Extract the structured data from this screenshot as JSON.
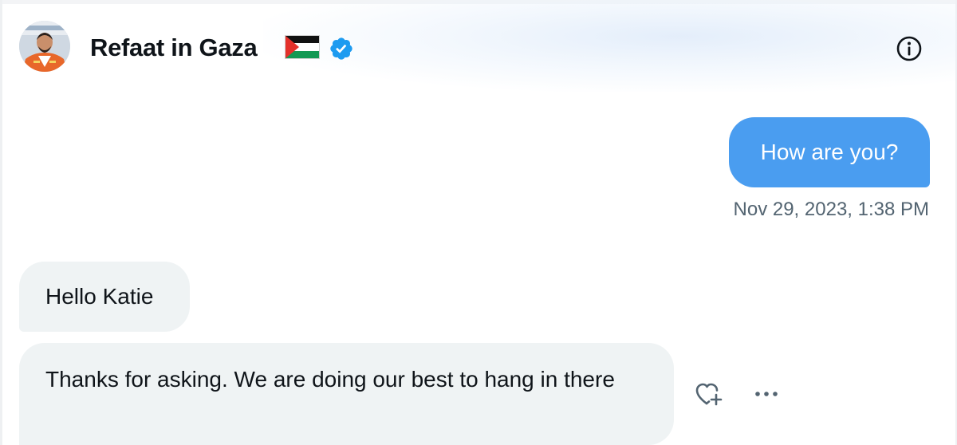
{
  "header": {
    "name": "Refaat in Gaza",
    "flag_emoji": "palestine-flag",
    "verified_icon": "verified-badge-icon",
    "info_icon": "info-icon"
  },
  "messages": [
    {
      "direction": "outgoing",
      "text": "How are you?"
    },
    {
      "direction": "incoming",
      "text": "Hello Katie"
    },
    {
      "direction": "incoming",
      "text": "Thanks for asking. We are doing our best to hang in there"
    }
  ],
  "timestamp": "Nov 29, 2023, 1:38 PM",
  "actions": {
    "react_icon": "add-reaction-icon",
    "more_icon": "more-options-icon"
  },
  "colors": {
    "outgoing_bubble": "#4a9df0",
    "incoming_bubble": "#eff3f4",
    "verified_blue": "#1d9bf0",
    "timestamp_gray": "#536471"
  }
}
